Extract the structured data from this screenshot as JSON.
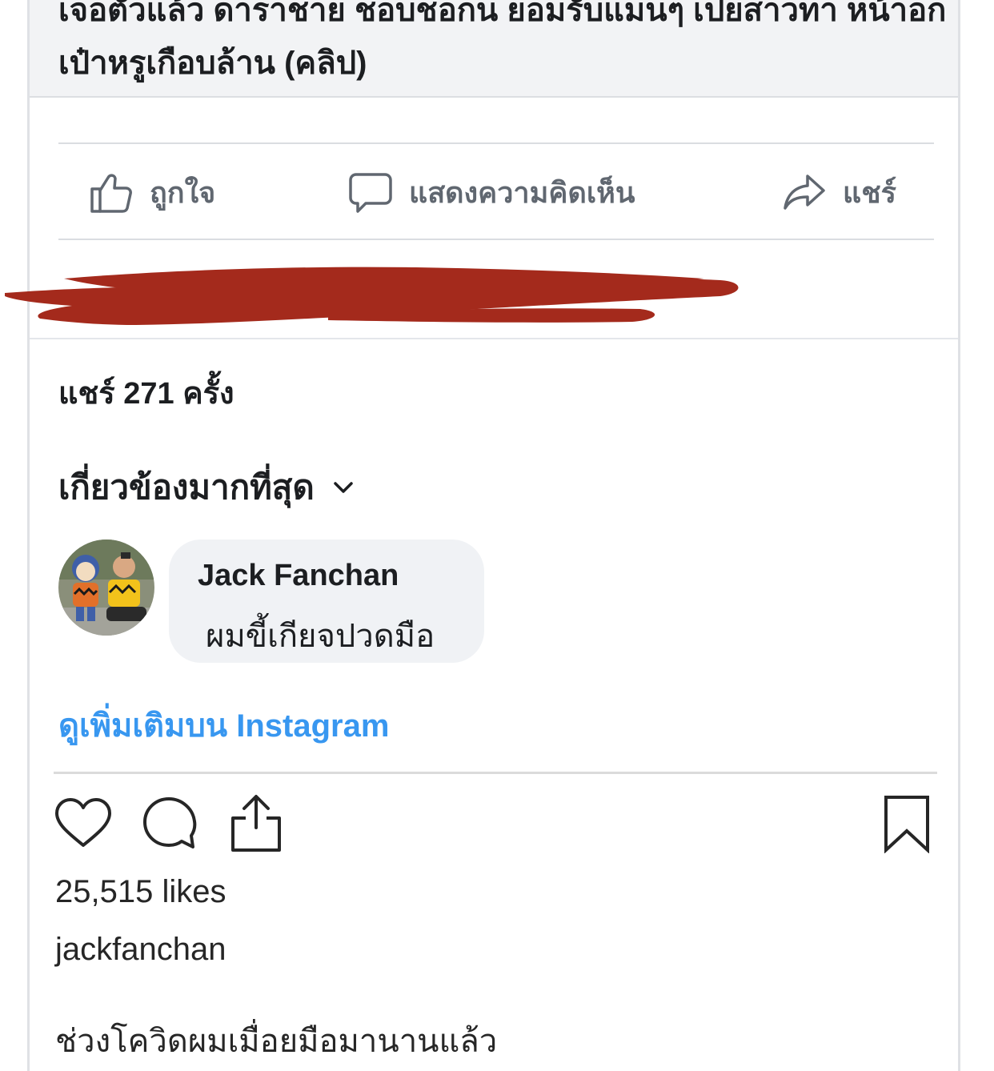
{
  "link_preview": {
    "title": "เจอตัวแล้ว ดาราชาย ชอบชอกน ยอมรับแมนๆ เปยสาวทา หน้าอก เป๋าหรูเกือบล้าน (คลิป)"
  },
  "fb_actions": {
    "like_label": "ถูกใจ",
    "comment_label": "แสดงความคิดเห็น",
    "share_label": "แชร์"
  },
  "fb_meta": {
    "shares_text": "แชร์ 271 ครั้ง",
    "sort_label": "เกี่ยวข้องมากที่สุด"
  },
  "comment": {
    "author": "Jack Fanchan",
    "text": "ผมขี้เกียจปวดมือ"
  },
  "instagram": {
    "see_more": "ดูเพิ่มเติมบน Instagram",
    "likes": "25,515 likes",
    "username": "jackfanchan",
    "caption": "ช่วงโควิดผมเมื่อยมือมานานแล้ว"
  },
  "colors": {
    "link_blue": "#3897f0",
    "redaction_red": "#a42a1c",
    "fb_gray": "#606770"
  },
  "icons": {
    "like": "thumbs-up-icon",
    "comment": "speech-bubble-icon",
    "share": "share-arrow-icon",
    "sort": "chevron-down-icon",
    "ig_like": "heart-icon",
    "ig_comment": "comment-icon",
    "ig_share": "upload-icon",
    "ig_save": "bookmark-icon"
  }
}
